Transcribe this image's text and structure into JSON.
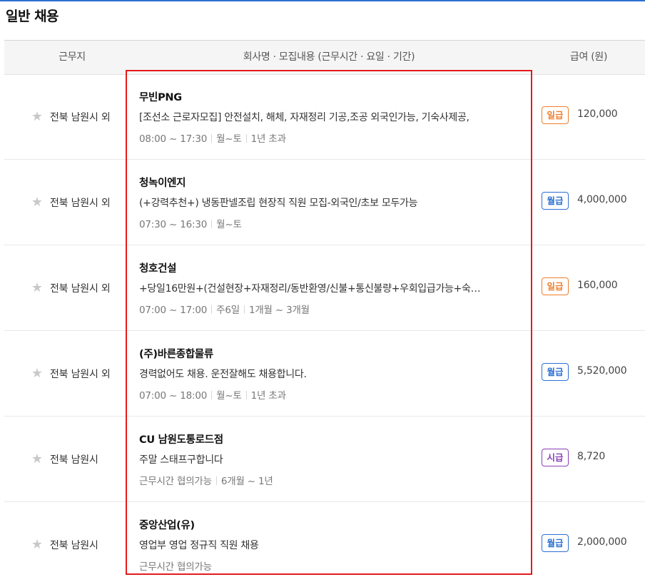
{
  "section": {
    "title": "일반 채용"
  },
  "header": {
    "location": "근무지",
    "info": "회사명 · 모집내용 (근무시간 · 요일 · 기간)",
    "pay": "급여 (원)"
  },
  "colors": {
    "accent_line": "#2b6fd1",
    "highlight_box": "#e41b1b",
    "badge_daily": "#f07d2c",
    "badge_monthly": "#2b6fd1",
    "badge_hourly": "#8b3fb5",
    "star": "#c8c8c8"
  },
  "icons": {
    "favorite": "star-icon"
  },
  "jobs": [
    {
      "location": "전북 남원시 외",
      "company": "무빈PNG",
      "description": "[조선소 근로자모집] 안전설치, 해체, 자재정리 기공,조공 외국인가능, 기숙사제공,",
      "meta": [
        "08:00 ~ 17:30",
        "월~토",
        "1년 초과"
      ],
      "pay_type": "일급",
      "pay_color": "#f07d2c",
      "pay": "120,000"
    },
    {
      "location": "전북 남원시 외",
      "company": "청녹이엔지",
      "description": "(+강력추천+) 냉동판넬조립 현장직 직원 모집-외국인/초보 모두가능",
      "meta": [
        "07:30 ~ 16:30",
        "월~토"
      ],
      "pay_type": "월급",
      "pay_color": "#2b6fd1",
      "pay": "4,000,000"
    },
    {
      "location": "전북 남원시 외",
      "company": "청호건설",
      "description": "+당일16만원+(건설현장+자재정리/동반환영/신불+통신불량+우회입급가능+숙…",
      "meta": [
        "07:00 ~ 17:00",
        "주6일",
        "1개월 ~ 3개월"
      ],
      "pay_type": "일급",
      "pay_color": "#f07d2c",
      "pay": "160,000"
    },
    {
      "location": "전북 남원시 외",
      "company": "(주)바른종합물류",
      "description": "경력없어도 채용. 운전잘해도 채용합니다.",
      "meta": [
        "07:00 ~ 18:00",
        "월~토",
        "1년 초과"
      ],
      "pay_type": "월급",
      "pay_color": "#2b6fd1",
      "pay": "5,520,000"
    },
    {
      "location": "전북 남원시",
      "company": "CU 남원도통로드점",
      "description": "주말 스태프구합니다",
      "meta": [
        "근무시간 협의가능",
        "6개월 ~ 1년"
      ],
      "pay_type": "시급",
      "pay_color": "#8b3fb5",
      "pay": "8,720"
    },
    {
      "location": "전북 남원시",
      "company": "중앙산업(유)",
      "description": "영업부 영업 정규직 직원 채용",
      "meta": [
        "근무시간 협의가능"
      ],
      "pay_type": "월급",
      "pay_color": "#2b6fd1",
      "pay": "2,000,000"
    }
  ]
}
